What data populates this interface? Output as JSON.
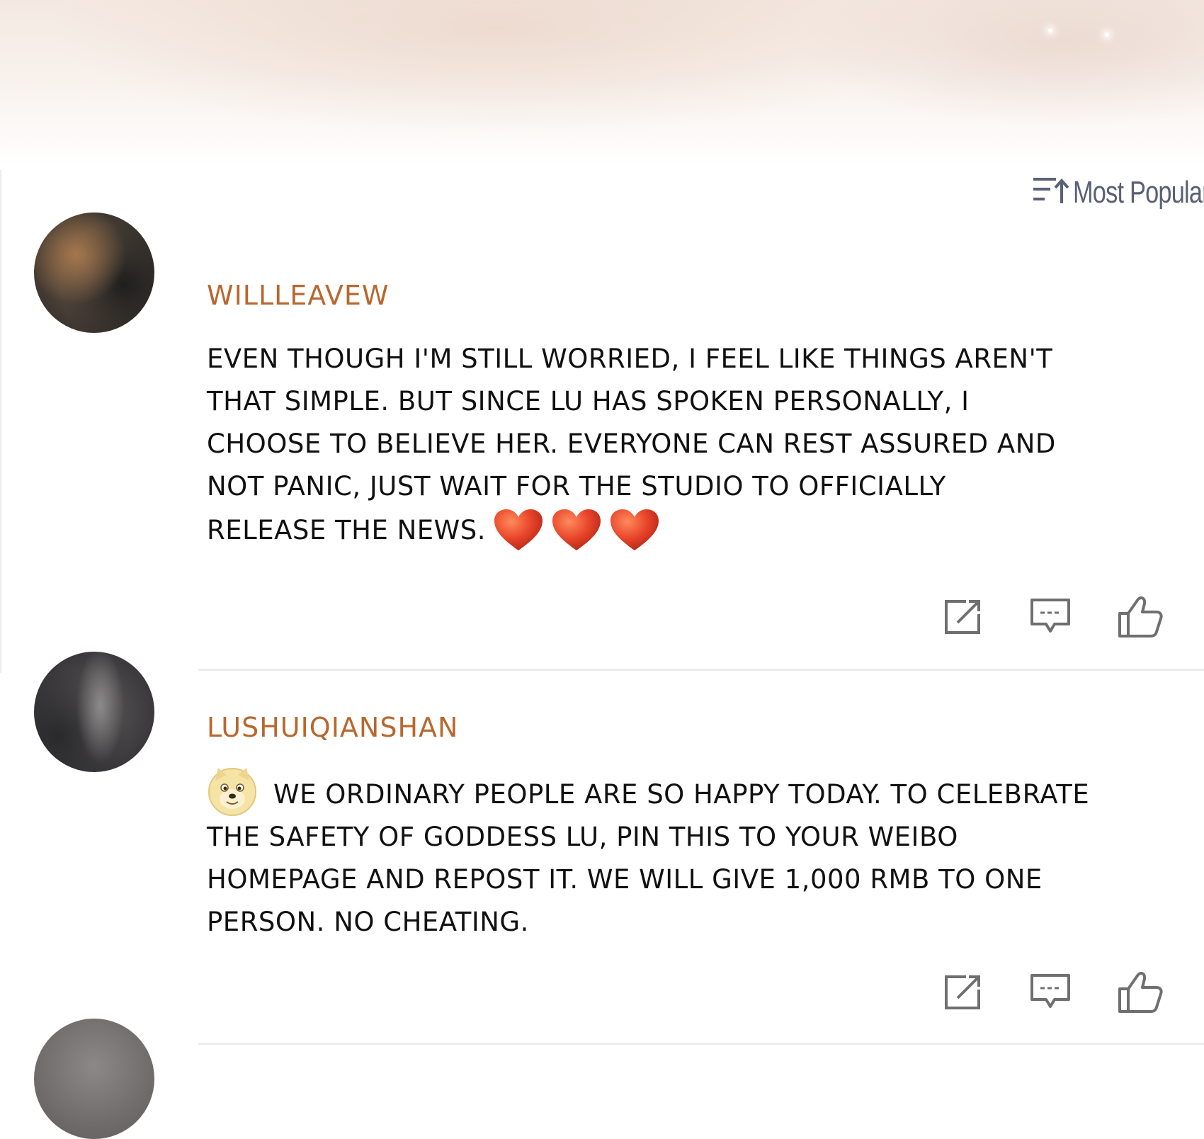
{
  "header": {
    "sort_label": "Most Popular",
    "sort_icon": "sort-ascending-icon"
  },
  "comments": [
    {
      "username": "WILLLEAVEW",
      "lines": [
        "EVEN THOUGH I'M STILL WORRIED, I FEEL LIKE THINGS AREN'T",
        "THAT SIMPLE. BUT SINCE LU HAS SPOKEN PERSONALLY, I",
        "CHOOSE TO BELIEVE HER. EVERYONE CAN REST ASSURED AND",
        "NOT PANIC, JUST WAIT FOR THE STUDIO TO OFFICIALLY",
        "RELEASE THE NEWS."
      ],
      "trailing_emoji": [
        "heart-emoji",
        "heart-emoji",
        "heart-emoji"
      ],
      "actions": [
        "repost-icon",
        "comment-icon",
        "like-icon"
      ]
    },
    {
      "username": "LUSHUIQIANSHAN",
      "leading_emoji": "doge-emoji",
      "lines": [
        "WE ORDINARY PEOPLE ARE SO HAPPY TODAY. TO CELEBRATE",
        "THE SAFETY OF GODDESS LU, PIN THIS TO YOUR WEIBO",
        "HOMEPAGE AND REPOST IT. WE WILL GIVE 1,000 RMB TO ONE",
        "PERSON. NO CHEATING."
      ],
      "actions": [
        "repost-icon",
        "comment-icon",
        "like-icon"
      ]
    }
  ],
  "colors": {
    "username": "#b8682f",
    "text": "#111111",
    "icon": "#6f6f6f",
    "sort": "#5a6075",
    "heart": "#e8452a"
  }
}
